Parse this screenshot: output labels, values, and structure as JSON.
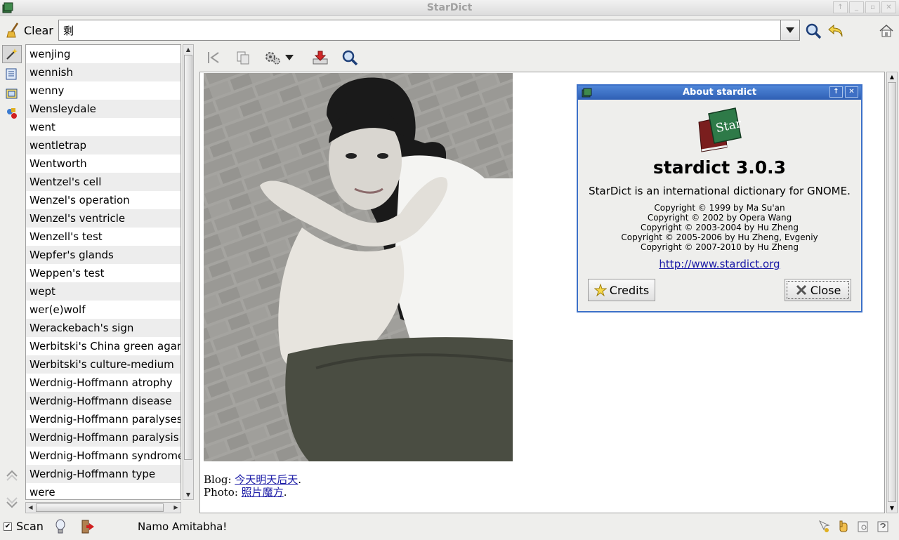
{
  "window": {
    "title": "StarDict"
  },
  "topbar": {
    "clear_label": "Clear",
    "search_value": "剩"
  },
  "wordlist": {
    "items": [
      "wenjing",
      "wennish",
      "wenny",
      "Wensleydale",
      "went",
      "wentletrap",
      "Wentworth",
      "Wentzel's cell",
      "Wenzel's operation",
      "Wenzel's ventricle",
      "Wenzell's test",
      "Wepfer's glands",
      "Weppen's test",
      "wept",
      "wer(e)wolf",
      "Werackebach's sign",
      "Werbitski's China green agar",
      "Werbitski's culture-medium",
      "Werdnig-Hoffmann atrophy",
      "Werdnig-Hoffmann disease",
      "Werdnig-Hoffmann paralyses",
      "Werdnig-Hoffmann paralysis",
      "Werdnig-Hoffmann syndrome",
      "Werdnig-Hoffmann type",
      "were"
    ]
  },
  "content": {
    "blog_label": "Blog: ",
    "blog_link": "今天明天后天",
    "photo_label": "Photo: ",
    "photo_link": "照片魔方",
    "period": "."
  },
  "about": {
    "title": "About stardict",
    "name": "stardict 3.0.3",
    "description": "StarDict is an international dictionary for GNOME.",
    "copyright": [
      "Copyright © 1999 by Ma Su'an",
      "Copyright © 2002 by Opera Wang",
      "Copyright © 2003-2004 by Hu Zheng",
      "Copyright © 2005-2006 by Hu Zheng, Evgeniy",
      "Copyright © 2007-2010 by Hu Zheng"
    ],
    "url": "http://www.stardict.org",
    "credits_label": "Credits",
    "close_label": "Close",
    "logo_text": "Star"
  },
  "statusbar": {
    "scan_label": "Scan",
    "message": "Namo Amitabha!"
  },
  "colors": {
    "dialog_title": "#3c70c8",
    "link": "#1a1aa6"
  }
}
